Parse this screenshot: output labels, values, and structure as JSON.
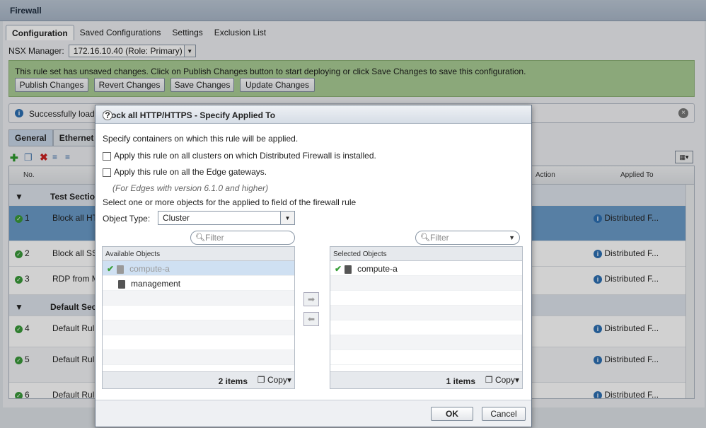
{
  "window_title": "Firewall",
  "tabs": [
    "Configuration",
    "Saved Configurations",
    "Settings",
    "Exclusion List"
  ],
  "nsx_manager": {
    "label": "NSX Manager:",
    "value": "172.16.10.40 (Role: Primary)"
  },
  "unsaved_banner": {
    "message": "This rule set has unsaved changes. Click on Publish Changes button to start deploying or click Save Changes to save this configuration.",
    "buttons": [
      "Publish Changes",
      "Revert Changes",
      "Save Changes",
      "Update Changes"
    ]
  },
  "info_bar": {
    "text": "Successfully loade"
  },
  "subtabs": [
    "General",
    "Ethernet"
  ],
  "grid": {
    "headers": {
      "no": "No.",
      "action": "Action",
      "applied_to": "Applied To"
    },
    "rows": [
      {
        "num": "",
        "name": "Test Section",
        "applied": "",
        "type": "section"
      },
      {
        "num": "1",
        "name": "Block all HT",
        "applied": "Distributed F...",
        "type": "rule"
      },
      {
        "num": "2",
        "name": "Block all SS",
        "applied": "Distributed F...",
        "type": "rule"
      },
      {
        "num": "3",
        "name": "RDP from M",
        "applied": "Distributed F...",
        "type": "rule"
      },
      {
        "num": "",
        "name": "Default Sect",
        "applied": "",
        "type": "section"
      },
      {
        "num": "4",
        "name": "Default Rul",
        "applied": "Distributed F...",
        "type": "rule"
      },
      {
        "num": "5",
        "name": "Default Rul",
        "applied": "Distributed F...",
        "type": "rule"
      },
      {
        "num": "6",
        "name": "Default Rul",
        "applied": "Distributed F...",
        "type": "rule"
      }
    ]
  },
  "modal": {
    "title": "Block all HTTP/HTTPS - Specify Applied To",
    "intro": "Specify containers on which this rule will be applied.",
    "opt_clusters": "Apply this rule on all clusters on which Distributed Firewall is installed.",
    "opt_edges": "Apply this rule on all the Edge gateways.",
    "edges_note": "(For Edges with version 6.1.0 and higher)",
    "select_prompt": "Select one or more objects for the applied to field of the firewall rule",
    "object_type_label": "Object Type:",
    "object_type_value": "Cluster",
    "filter_placeholder": "Filter",
    "available": {
      "header": "Available Objects",
      "items": [
        "compute-a",
        "management"
      ],
      "count": "2 items",
      "copy": "Copy"
    },
    "selected": {
      "header": "Selected Objects",
      "items": [
        "compute-a"
      ],
      "count": "1 items",
      "copy": "Copy"
    },
    "ok": "OK",
    "cancel": "Cancel"
  }
}
